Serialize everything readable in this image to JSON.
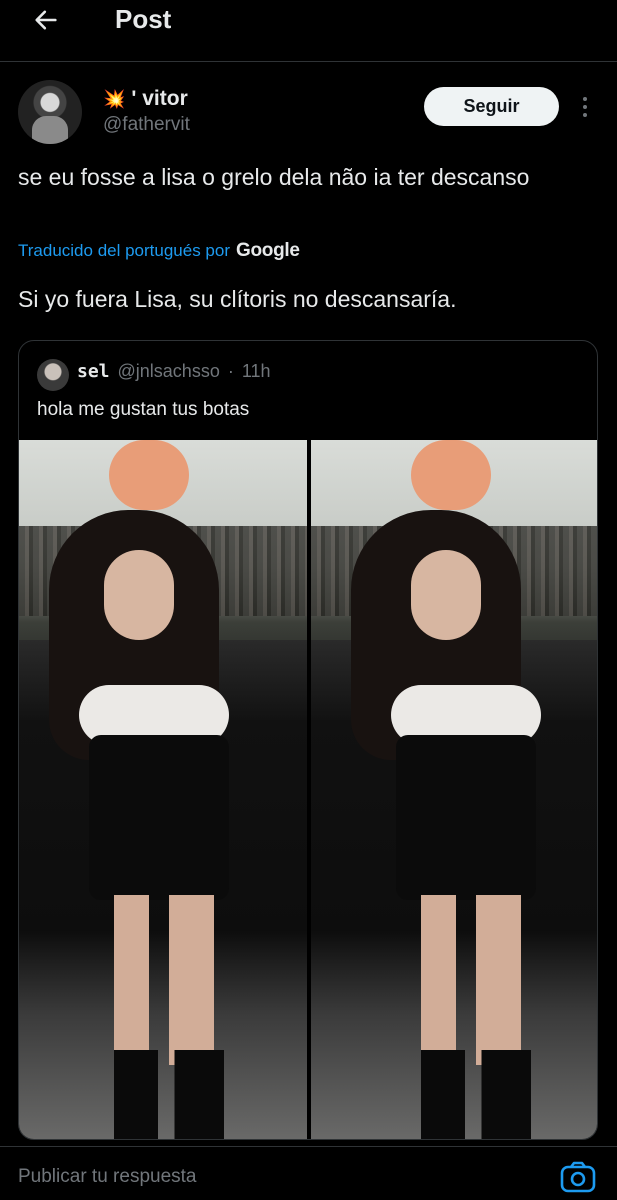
{
  "header": {
    "title": "Post"
  },
  "author": {
    "emoji": "💥",
    "name": "' vitor",
    "handle": "@fathervit",
    "follow_label": "Seguir"
  },
  "post": {
    "text": "se eu fosse a lisa o grelo dela não ia ter descanso",
    "translated_by_label": "Traducido del portugués por",
    "translator_brand": "Google",
    "translation": "Si yo fuera Lisa, su clítoris no descansaría."
  },
  "quote": {
    "name": "sel",
    "handle": "@jnlsachsso",
    "separator": "·",
    "time": "11h",
    "text": "hola me gustan tus botas"
  },
  "composer": {
    "placeholder": "Publicar tu respuesta"
  },
  "icons": {
    "back": "arrow-left-icon",
    "more": "more-vertical-icon",
    "camera": "camera-icon"
  },
  "colors": {
    "accent": "#1d9bf0",
    "background": "#000000",
    "secondary_text": "#71767b"
  }
}
